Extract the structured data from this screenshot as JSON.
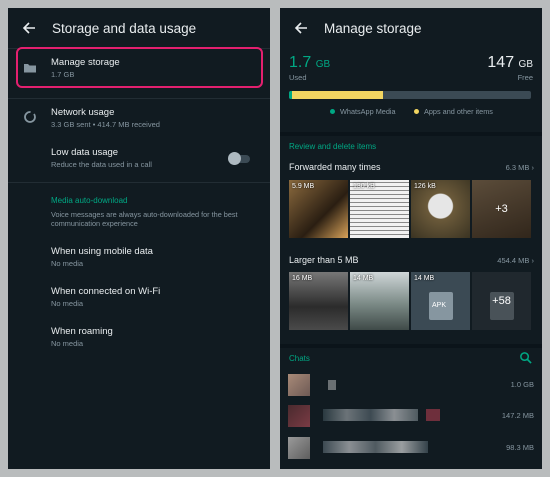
{
  "left": {
    "title": "Storage and data usage",
    "manage": {
      "title": "Manage storage",
      "sub": "1.7 GB"
    },
    "network": {
      "title": "Network usage",
      "sub": "3.3 GB sent • 414.7 MB received"
    },
    "lowdata": {
      "title": "Low data usage",
      "sub": "Reduce the data used in a call",
      "enabled": false
    },
    "autodl": {
      "header": "Media auto-download",
      "note": "Voice messages are always auto-downloaded for the best communication experience",
      "items": [
        {
          "title": "When using mobile data",
          "sub": "No media"
        },
        {
          "title": "When connected on Wi-Fi",
          "sub": "No media"
        },
        {
          "title": "When roaming",
          "sub": "No media"
        }
      ]
    }
  },
  "right": {
    "title": "Manage storage",
    "used": {
      "value": "1.7",
      "unit": "GB",
      "label": "Used"
    },
    "free": {
      "value": "147",
      "unit": "GB",
      "label": "Free"
    },
    "bar": {
      "whatsapp_fraction": 0.012,
      "other_fraction": 0.375
    },
    "legend": {
      "whatsapp": "WhatsApp Media",
      "other": "Apps and other items"
    },
    "review_header": "Review and delete items",
    "forwarded": {
      "title": "Forwarded many times",
      "size": "6.3 MB",
      "thumbs": [
        "5.9 MB",
        "130 kB",
        "126 kB",
        ""
      ],
      "more": "+3"
    },
    "larger": {
      "title": "Larger than 5 MB",
      "size": "454.4 MB",
      "thumbs": [
        "16 MB",
        "14 MB",
        "14 MB",
        ""
      ],
      "apk": "APK",
      "more": "+58"
    },
    "chats_header": "Chats",
    "chats": [
      {
        "size": "1.0 GB"
      },
      {
        "size": "147.2 MB"
      },
      {
        "size": "98.3 MB"
      }
    ]
  },
  "colors": {
    "accent": "#00a884",
    "highlight": "#e3206f",
    "bg": "#111b21",
    "yellow": "#f2d561"
  }
}
